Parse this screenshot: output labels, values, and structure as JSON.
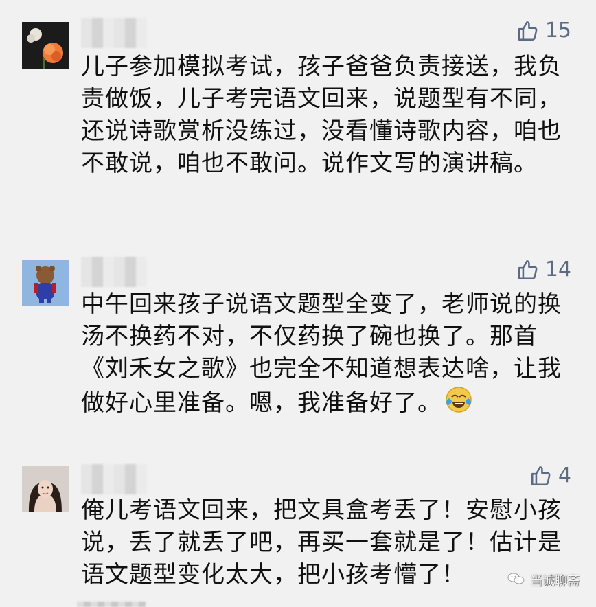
{
  "comments": [
    {
      "avatar": "avatar-flower-icon",
      "likes": "15",
      "text": "儿子参加模拟考试，孩子爸爸负责接送，我负责做饭，儿子考完语文回来，说题型有不同，还说诗歌赏析没练过，没看懂诗歌内容，咱也不敢说，咱也不敢问。说作文写的演讲稿。"
    },
    {
      "avatar": "avatar-teddy-bear-icon",
      "likes": "14",
      "text": "中午回来孩子说语文题型全变了，老师说的换汤不换药不对，不仅药换了碗也换了。那首《刘禾女之歌》也完全不知道想表达啥，让我做好心里准备。嗯，我准备好了。"
    },
    {
      "avatar": "avatar-portrait-icon",
      "likes": "4",
      "text": "俺儿考语文回来，把文具盒考丢了！安慰小孩说，丢了就丢了吧，再买一套就是了！估计是语文题型变化太大，把小孩考懵了！"
    }
  ],
  "watermark": {
    "text": "当诚聊斋"
  },
  "colors": {
    "background": "#f1f1f1",
    "likes": "#5b6b86",
    "text": "#111111"
  }
}
